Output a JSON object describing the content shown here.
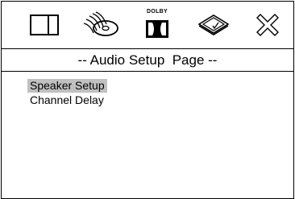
{
  "toolbar": {
    "icons": [
      {
        "name": "general-setup-icon"
      },
      {
        "name": "audio-setup-icon"
      },
      {
        "name": "dolby-setup-icon",
        "label": "DOLBY"
      },
      {
        "name": "preference-setup-icon"
      },
      {
        "name": "exit-setup-icon"
      }
    ]
  },
  "page": {
    "title": "-- Audio Setup  Page --"
  },
  "menu": {
    "items": [
      {
        "label": "Speaker Setup",
        "selected": true
      },
      {
        "label": "Channel Delay",
        "selected": false
      }
    ]
  },
  "colors": {
    "border": "#000000",
    "highlight": "#c0c0c0",
    "background": "#ffffff"
  }
}
